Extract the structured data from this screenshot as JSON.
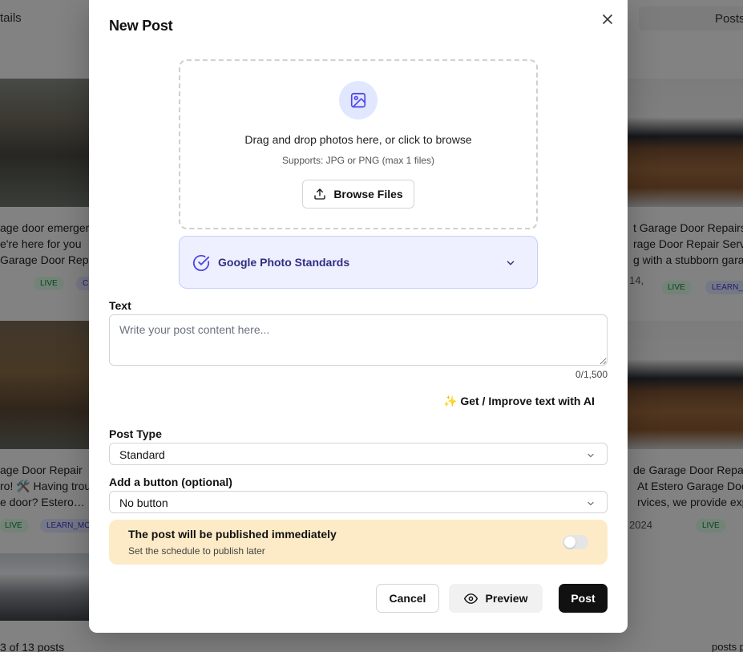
{
  "background": {
    "top_left_text": "tails",
    "top_right_tab": "Posts",
    "cards": [
      {
        "lines": [
          "age door emerger",
          "e're here for you",
          "Garage Door Repa"
        ],
        "badges": [
          "LIVE",
          "C"
        ]
      },
      {
        "lines": [
          "t Garage Door Repairs",
          "rage Door Repair Serv",
          "g with a stubborn gara"
        ],
        "date": "14,",
        "badges": [
          "LIVE",
          "LEARN_"
        ]
      },
      {
        "lines": [
          "age Door Repair",
          "ro! 🛠️ Having trou",
          "e door? Estero…"
        ],
        "badges": [
          "LIVE",
          "LEARN_MO"
        ]
      },
      {
        "lines": [
          "de Garage Door Repair",
          "At Estero Garage Doo",
          "rvices, we provide exp"
        ],
        "date": "2024",
        "badges": [
          "LIVE"
        ]
      }
    ],
    "footer_left": "3 of 13 posts",
    "footer_right": "posts p"
  },
  "modal": {
    "title": "New Post",
    "dropzone": {
      "main_text": "Drag and drop photos here, or click to browse",
      "sub_text": "Supports: JPG or PNG (max 1 files)",
      "browse_label": "Browse Files"
    },
    "standards_label": "Google Photo Standards",
    "text_label": "Text",
    "text_placeholder": "Write your post content here...",
    "text_value": "",
    "char_counter": "0/1,500",
    "ai_button": "✨ Get / Improve text with AI",
    "post_type_label": "Post Type",
    "post_type_value": "Standard",
    "button_label": "Add a button (optional)",
    "button_value": "No button",
    "publish": {
      "title": "The post will be published immediately",
      "subtitle": "Set the schedule to publish later",
      "scheduled": false
    },
    "actions": {
      "cancel": "Cancel",
      "preview": "Preview",
      "post": "Post"
    }
  },
  "colors": {
    "accent": "#4f46e5",
    "standards_bg": "#eef0ff",
    "publish_bg": "#fcebc6",
    "primary_button": "#111111"
  },
  "icons": {
    "close": "close-icon",
    "image": "image-icon",
    "upload": "upload-icon",
    "check_circle": "check-circle-icon",
    "chevron": "chevron-down-icon",
    "eye": "eye-icon"
  }
}
